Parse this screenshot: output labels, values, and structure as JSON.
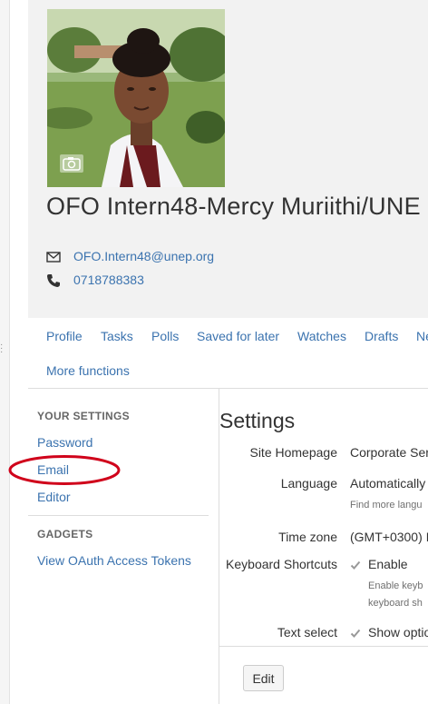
{
  "profile": {
    "name": "OFO Intern48-Mercy Muriithi/UNE",
    "email": "OFO.Intern48@unep.org",
    "phone": "0718788383"
  },
  "icons": {
    "camera": "camera-icon",
    "email": "envelope-icon",
    "phone": "phone-icon",
    "checkbox": "checkmark-icon"
  },
  "nav": {
    "row1": [
      "Profile",
      "Tasks",
      "Polls",
      "Saved for later",
      "Watches",
      "Drafts",
      "Ne"
    ],
    "more_functions": "More functions"
  },
  "sidebar": {
    "your_settings_heading": "YOUR SETTINGS",
    "items": [
      "Password",
      "Email",
      "Editor"
    ],
    "gadgets_heading": "GADGETS",
    "gadget_items": [
      "View OAuth Access Tokens"
    ]
  },
  "settings": {
    "title": "Settings",
    "rows": {
      "site_homepage": {
        "label": "Site Homepage",
        "value": "Corporate Ser"
      },
      "language": {
        "label": "Language",
        "value": "Automatically",
        "hint": "Find more langu"
      },
      "time_zone": {
        "label": "Time zone",
        "value": "(GMT+0300) I"
      },
      "keyboard_shortcuts": {
        "label": "Keyboard Shortcuts",
        "value": "Enable",
        "hint_line1": "Enable keyb",
        "hint_line2": "keyboard sh"
      },
      "text_select": {
        "label": "Text select",
        "value": "Show optio"
      }
    },
    "edit_label": "Edit"
  },
  "colors": {
    "link": "#3b73af",
    "header_bg": "#f2f2f2",
    "annotation": "#d0021b"
  }
}
